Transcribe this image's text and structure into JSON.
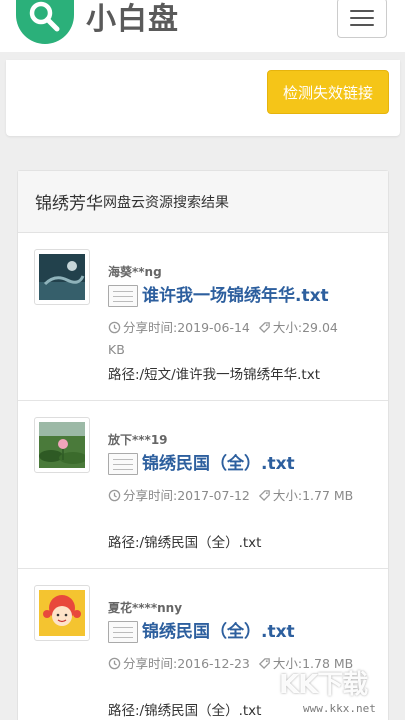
{
  "header": {
    "brand": "小白盘",
    "logo_icon": "search-icon",
    "menu_icon": "hamburger-menu-icon",
    "brand_color": "#2bb07a"
  },
  "top_panel": {
    "check_button": "检测失效链接",
    "button_color": "#f5c518"
  },
  "results": {
    "keyword": "锦绣芳华",
    "suffix": "网盘云资源搜索结果",
    "items": [
      {
        "user": "海葵**ng",
        "title": "谁许我一场锦绣年华.txt",
        "share_label": "分享时间:",
        "share_time": "2019-06-14",
        "size_label": "大小:",
        "size": "29.04 KB",
        "path": "路径:/短文/谁许我一场锦绣年华.txt"
      },
      {
        "user": "放下***19",
        "title": "锦绣民国（全）.txt",
        "share_label": "分享时间:",
        "share_time": "2017-07-12",
        "size_label": "大小:",
        "size": "1.77 MB",
        "path": "路径:/锦绣民国（全）.txt"
      },
      {
        "user": "夏花****nny",
        "title": "锦绣民国（全）.txt",
        "share_label": "分享时间:",
        "share_time": "2016-12-23",
        "size_label": "大小:",
        "size": "1.78 MB",
        "path": "路径:/锦绣民国（全）.txt"
      }
    ]
  },
  "watermark": {
    "text": "KK下载",
    "url": "www.kkx.net"
  }
}
